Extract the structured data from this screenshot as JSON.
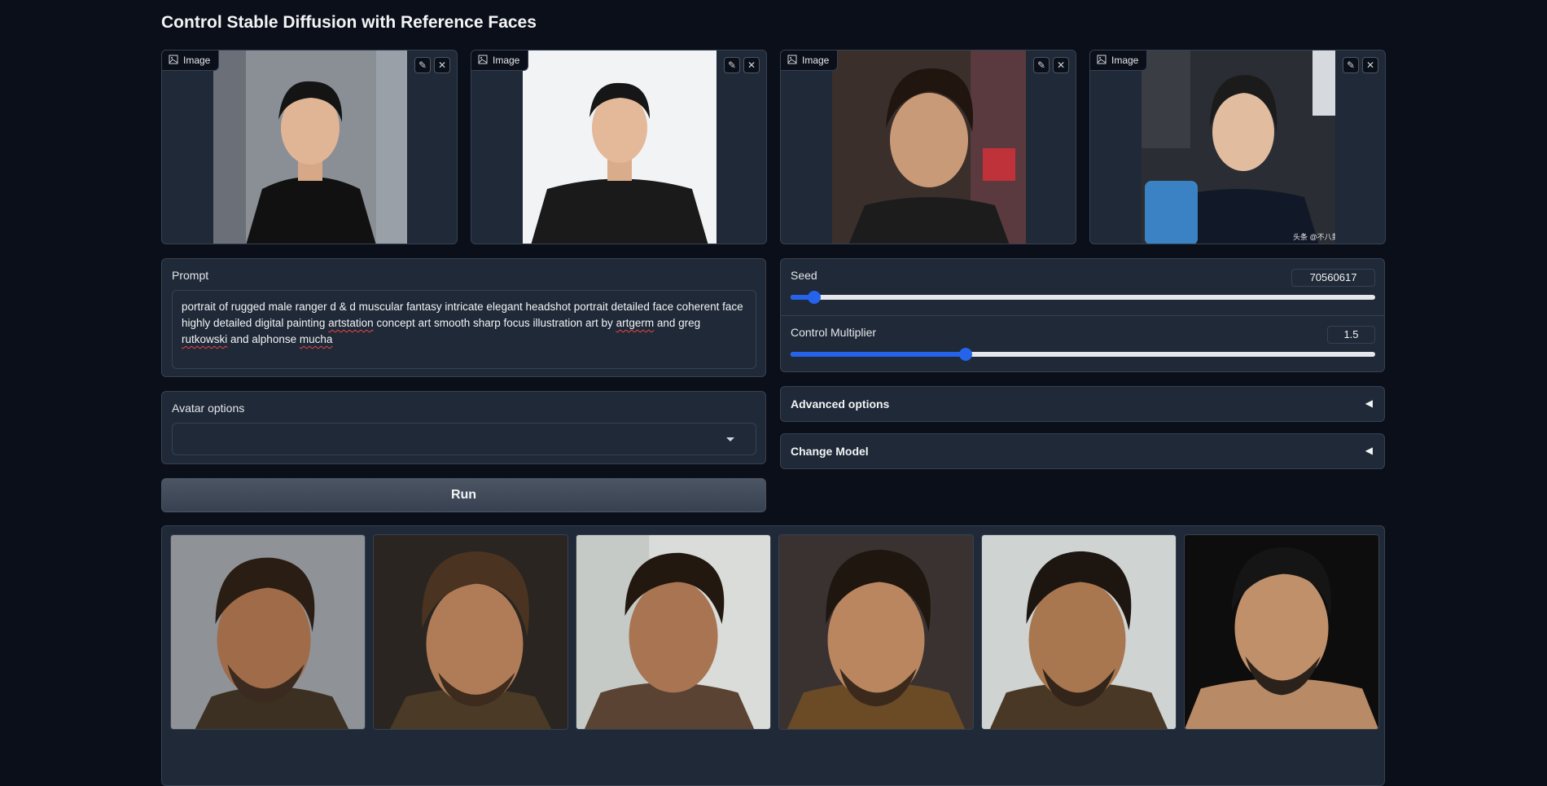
{
  "header": {
    "title": "Control Stable Diffusion with Reference Faces"
  },
  "reference_images": [
    {
      "label": "Image"
    },
    {
      "label": "Image"
    },
    {
      "label": "Image"
    },
    {
      "label": "Image",
      "watermark": "头条 @不八卦"
    }
  ],
  "prompt": {
    "label": "Prompt",
    "value": "portrait of rugged male ranger d & d muscular fantasy intricate elegant headshot portrait detailed face coherent face highly detailed digital painting artstation concept art smooth sharp focus illustration art by artgerm and greg rutkowski and alphonse mucha"
  },
  "avatar_options": {
    "label": "Avatar options",
    "value": ""
  },
  "seed": {
    "label": "Seed",
    "value": "70560617",
    "fraction": 0.04
  },
  "control_multiplier": {
    "label": "Control Multiplier",
    "value": "1.5",
    "fraction": 0.3
  },
  "advanced_options": {
    "label": "Advanced options",
    "arrow": "◀"
  },
  "change_model": {
    "label": "Change Model",
    "arrow": "◀"
  },
  "run_button": {
    "label": "Run"
  },
  "icons": {
    "image": "image-icon",
    "edit": "pencil-icon",
    "clear": "close-icon"
  },
  "colors": {
    "accent": "#2563eb",
    "background": "#0b0f19",
    "panel": "#1f2937"
  }
}
